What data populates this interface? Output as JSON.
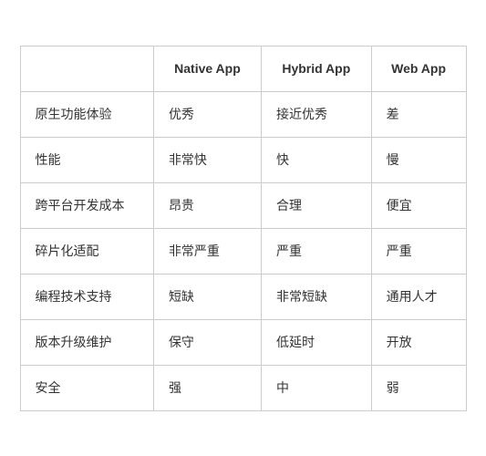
{
  "table": {
    "headers": [
      "",
      "Native App",
      "Hybrid App",
      "Web App"
    ],
    "rows": [
      {
        "feature": "原生功能体验",
        "native": "优秀",
        "hybrid": "接近优秀",
        "web": "差"
      },
      {
        "feature": "性能",
        "native": "非常快",
        "hybrid": "快",
        "web": "慢"
      },
      {
        "feature": "跨平台开发成本",
        "native": "昂贵",
        "hybrid": "合理",
        "web": "便宜"
      },
      {
        "feature": "碎片化适配",
        "native": "非常严重",
        "hybrid": "严重",
        "web": "严重"
      },
      {
        "feature": "编程技术支持",
        "native": "短缺",
        "hybrid": "非常短缺",
        "web": "通用人才"
      },
      {
        "feature": "版本升级维护",
        "native": "保守",
        "hybrid": "低延时",
        "web": "开放"
      },
      {
        "feature": "安全",
        "native": "强",
        "hybrid": "中",
        "web": "弱"
      }
    ]
  }
}
